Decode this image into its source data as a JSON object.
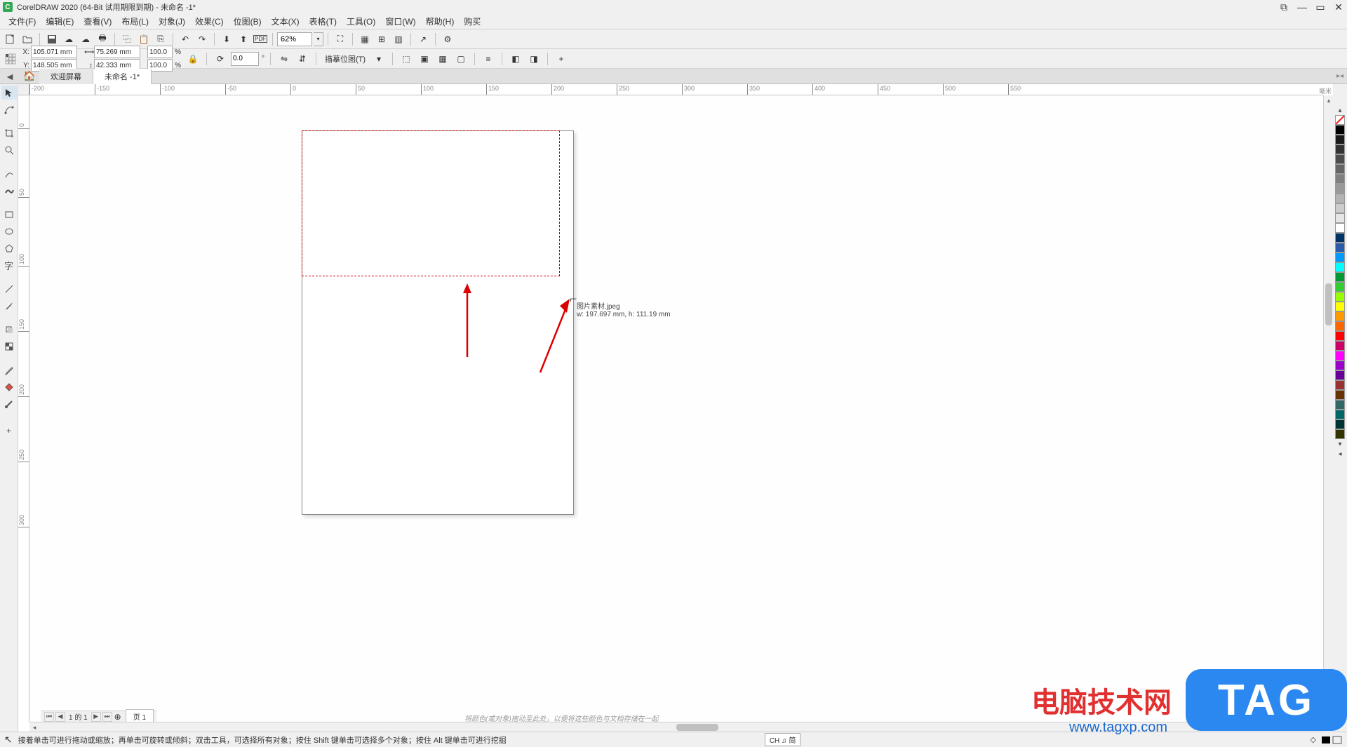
{
  "title": "CorelDRAW 2020 (64-Bit 试用期限到期) - 未命名 -1*",
  "menus": [
    "文件(F)",
    "编辑(E)",
    "查看(V)",
    "布局(L)",
    "对象(J)",
    "效果(C)",
    "位图(B)",
    "文本(X)",
    "表格(T)",
    "工具(O)",
    "窗口(W)",
    "帮助(H)",
    "购买"
  ],
  "zoom": "62%",
  "coords": {
    "x_label": "X:",
    "x": "105.071 mm",
    "y_label": "Y:",
    "y": "148.505 mm",
    "w_label": "⟷",
    "w": "75.269 mm",
    "h_label": "↕",
    "h": "42.333 mm",
    "sx": "100.0",
    "sy": "100.0",
    "pct": "%",
    "rot": "0.0"
  },
  "snap_label": "描摹位图(T)",
  "tabs": {
    "welcome": "欢迎屏幕",
    "doc": "未命名 -1*"
  },
  "ruler_unit": "毫米",
  "ruler_h": [
    "-200",
    "-150",
    "-100",
    "-50",
    "0",
    "50",
    "100",
    "150",
    "200",
    "250",
    "300",
    "350",
    "400",
    "450",
    "500",
    "550"
  ],
  "ruler_v": [
    "0",
    "50",
    "100",
    "150",
    "200",
    "250",
    "300"
  ],
  "tooltip": {
    "name": "图片素材.jpeg",
    "dims": "w: 197.697 mm, h: 111.19 mm"
  },
  "page_nav": {
    "count": "1 的 1",
    "page_label": "页 1"
  },
  "hint": "将颜色(或对象)拖动至此处，以便将这些颜色与文档存储在一起",
  "status": "接着单击可进行拖动或缩放；再单击可旋转或倾斜；双击工具，可选择所有对象；按住 Shift 键单击可选择多个对象；按住 Alt 键单击可进行挖掘",
  "ime": "CH ♫ 简",
  "palette": [
    "#000000",
    "#1a1a1a",
    "#333333",
    "#4d4d4d",
    "#666666",
    "#808080",
    "#999999",
    "#b3b3b3",
    "#cccccc",
    "#e6e6e6",
    "#ffffff",
    "#003366",
    "#2a5caa",
    "#0099ff",
    "#00ffff",
    "#009933",
    "#33cc33",
    "#99ff00",
    "#ffff00",
    "#ff9900",
    "#ff6600",
    "#ff0000",
    "#cc0066",
    "#ff00ff",
    "#9900cc",
    "#660099",
    "#993333",
    "#663300",
    "#336666",
    "#006666",
    "#003333",
    "#333300"
  ],
  "wm": {
    "text": "电脑技术网",
    "url": "www.tagxp.com",
    "tag": "TAG"
  }
}
